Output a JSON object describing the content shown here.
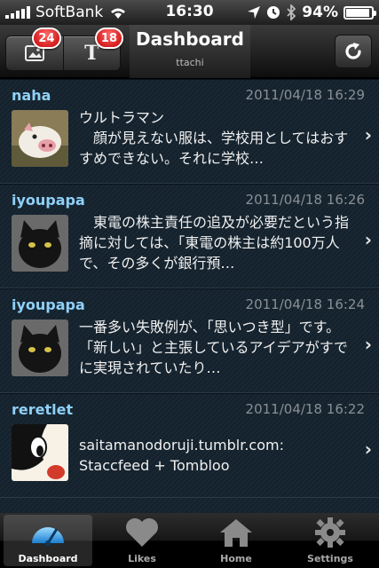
{
  "status_bar": {
    "carrier": "SoftBank",
    "time": "16:30",
    "battery": "94%",
    "battery_level": 0.94
  },
  "nav": {
    "title": "Dashboard",
    "subtitle": "ttachi",
    "photo_badge": "24",
    "text_badge": "18",
    "text_button_glyph": "T"
  },
  "posts": [
    {
      "user": "naha",
      "date": "2011/04/18 16:29",
      "text": "ウルトラマン\n　顔が見えない服は、学校用としてはおすすめできない。それに学校…"
    },
    {
      "user": "iyoupapa",
      "date": "2011/04/18 16:26",
      "text": "　東電の株主責任の追及が必要だという指摘に対しては、「東電の株主は約100万人で、その多くが銀行預…"
    },
    {
      "user": "iyoupapa",
      "date": "2011/04/18 16:24",
      "text": "一番多い失敗例が、「思いつき型」です。「新しい」と主張しているアイデアがすでに実現されていたり…"
    },
    {
      "user": "reretlet",
      "date": "2011/04/18 16:22",
      "text": "saitamanodoruji.tumblr.com:\nStaccfeed + Tombloo"
    }
  ],
  "tabs": [
    {
      "label": "Dashboard"
    },
    {
      "label": "Likes"
    },
    {
      "label": "Home"
    },
    {
      "label": "Settings"
    }
  ],
  "colors": {
    "username": "#8fd0f7",
    "badge": "#d40000"
  }
}
